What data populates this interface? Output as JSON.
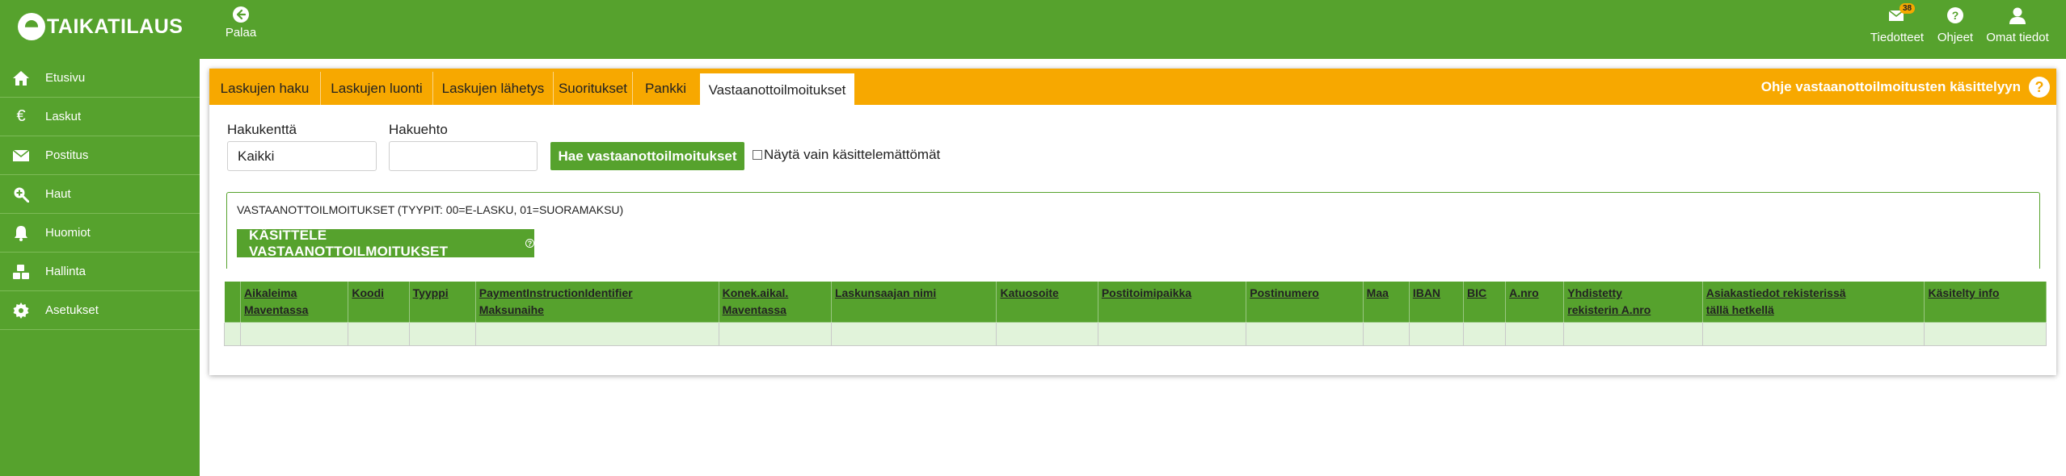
{
  "app": {
    "logo_text": "TAIKATILAUS"
  },
  "header": {
    "back_label": "Palaa",
    "actions": [
      {
        "label": "Tiedotteet",
        "icon": "envelope-icon",
        "badge": "38"
      },
      {
        "label": "Ohjeet",
        "icon": "help-icon"
      },
      {
        "label": "Omat tiedot",
        "icon": "user-icon"
      }
    ]
  },
  "sidebar": {
    "items": [
      {
        "label": "Etusivu",
        "icon": "home-icon"
      },
      {
        "label": "Laskut",
        "icon": "euro-icon"
      },
      {
        "label": "Postitus",
        "icon": "envelope-icon"
      },
      {
        "label": "Haut",
        "icon": "search-plus-icon"
      },
      {
        "label": "Huomiot",
        "icon": "bell-icon"
      },
      {
        "label": "Hallinta",
        "icon": "cubes-icon"
      },
      {
        "label": "Asetukset",
        "icon": "gear-icon"
      }
    ]
  },
  "tabs": [
    {
      "label": "Laskujen haku"
    },
    {
      "label": "Laskujen luonti"
    },
    {
      "label": "Laskujen lähetys"
    },
    {
      "label": "Suoritukset"
    },
    {
      "label": "Pankki"
    },
    {
      "label": "Vastaanottoilmoitukset",
      "active": true
    }
  ],
  "help_link": {
    "label": "Ohje vastaanottoilmoitusten käsittelyyn",
    "icon_text": "?"
  },
  "search": {
    "field_label": "Hakukenttä",
    "field_value": "Kaikki",
    "criteria_label": "Hakuehto",
    "criteria_value": "",
    "search_button": "Hae vastaanottoilmoitukset",
    "checkbox_label": "Näytä vain käsittelemättömät",
    "checkbox_checked": false
  },
  "notices": {
    "title": "VASTAANOTTOILMOITUKSET (TYYPIT: 00=E-LASKU, 01=SUORAMAKSU)",
    "process_button": "KÄSITTELE VASTAANOTTOILMOITUKSET",
    "process_help_glyph": "?"
  },
  "table": {
    "columns": [
      {
        "label": "",
        "w": 20
      },
      {
        "label": "Aikaleima\nMaventassa",
        "w": 133
      },
      {
        "label": "Koodi",
        "w": 75
      },
      {
        "label": "Tyyppi",
        "w": 82
      },
      {
        "label": "PaymentInstructionIdentifier\nMaksunaihe",
        "w": 300
      },
      {
        "label": "Konek.aikal.\nMaventassa",
        "w": 139
      },
      {
        "label": "Laskunsaajan nimi",
        "w": 204
      },
      {
        "label": "Katuosoite",
        "w": 125
      },
      {
        "label": "Postitoimipaikka",
        "w": 183
      },
      {
        "label": "Postinumero",
        "w": 144
      },
      {
        "label": "Maa",
        "w": 57
      },
      {
        "label": "IBAN",
        "w": 67
      },
      {
        "label": "BIC",
        "w": 52
      },
      {
        "label": "A.nro",
        "w": 72
      },
      {
        "label": "Yhdistetty\nrekisterin A.nro",
        "w": 171
      },
      {
        "label": "Asiakastiedot rekisterissä\ntällä hetkellä",
        "w": 274
      },
      {
        "label": "Käsitelty info",
        "w": 150
      }
    ],
    "rows": [
      [
        "",
        "",
        "",
        "",
        "",
        "",
        "",
        "",
        "",
        "",
        "",
        "",
        "",
        "",
        "",
        "",
        ""
      ]
    ]
  }
}
